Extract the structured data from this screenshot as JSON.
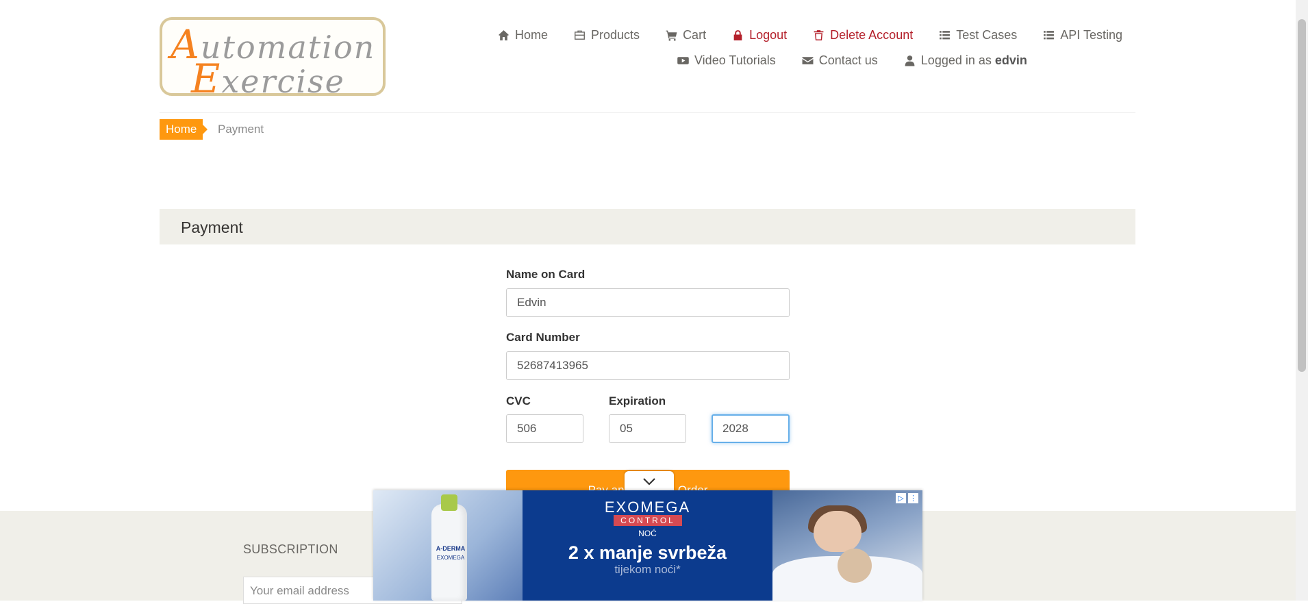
{
  "logo": {
    "line1_cap": "A",
    "line1_rest": "utomation",
    "line2_cap": "E",
    "line2_rest": "xercise"
  },
  "nav": {
    "home": "Home",
    "products": "Products",
    "cart": "Cart",
    "logout": "Logout",
    "delete_account": "Delete Account",
    "test_cases": "Test Cases",
    "api_testing": "API Testing",
    "video_tutorials": "Video Tutorials",
    "contact_us": "Contact us",
    "logged_in_prefix": "Logged in as",
    "username": "edvin"
  },
  "breadcrumb": {
    "home": "Home",
    "current": "Payment"
  },
  "payment": {
    "title": "Payment",
    "name_label": "Name on Card",
    "name_value": "Edvin",
    "card_label": "Card Number",
    "card_value": "52687413965",
    "cvc_label": "CVC",
    "cvc_value": "506",
    "expiration_label": "Expiration",
    "exp_month_value": "05",
    "exp_year_value": "2028",
    "pay_button": "Pay and Confirm Order"
  },
  "footer": {
    "subscription_title": "SUBSCRIPTION",
    "email_placeholder": "Your email address"
  },
  "ad": {
    "brand": "EXOMEGA",
    "line": "CONTROL",
    "sub": "NOĆ",
    "headline": "2 x manje svrbeža",
    "tagline": "tijekom noći*",
    "bottle_brand": "A-DERMA",
    "bottle_product": "EXOMEGA"
  },
  "colors": {
    "accent": "#fe980f",
    "danger": "#b4202b",
    "panel": "#f0efe9",
    "focus": "#66afe9"
  }
}
